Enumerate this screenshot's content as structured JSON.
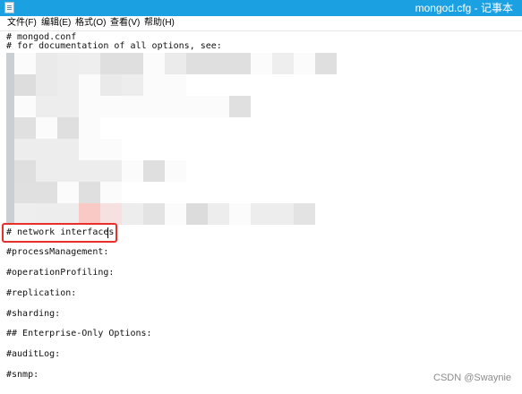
{
  "window": {
    "title": "mongod.cfg - 记事本",
    "accent_color": "#1ba1e2",
    "icon": "notepad-icon"
  },
  "menu": [
    {
      "label": "文件(F)"
    },
    {
      "label": "编辑(E)"
    },
    {
      "label": "格式(O)"
    },
    {
      "label": "查看(V)"
    },
    {
      "label": "帮助(H)"
    }
  ],
  "editor": {
    "lines": [
      "# mongod.conf",
      "# for documentation of all options, see:",
      "# network interfaces",
      "#processManagement:",
      "#operationProfiling:",
      "#replication:",
      "#sharding:",
      "## Enterprise-Only Options:",
      "#auditLog:",
      "#snmp:"
    ],
    "highlighted_line": "# network interfaces",
    "highlight_color": "#e8302b",
    "redacted_region": "pixelated"
  },
  "watermark": "CSDN @Swaynie"
}
